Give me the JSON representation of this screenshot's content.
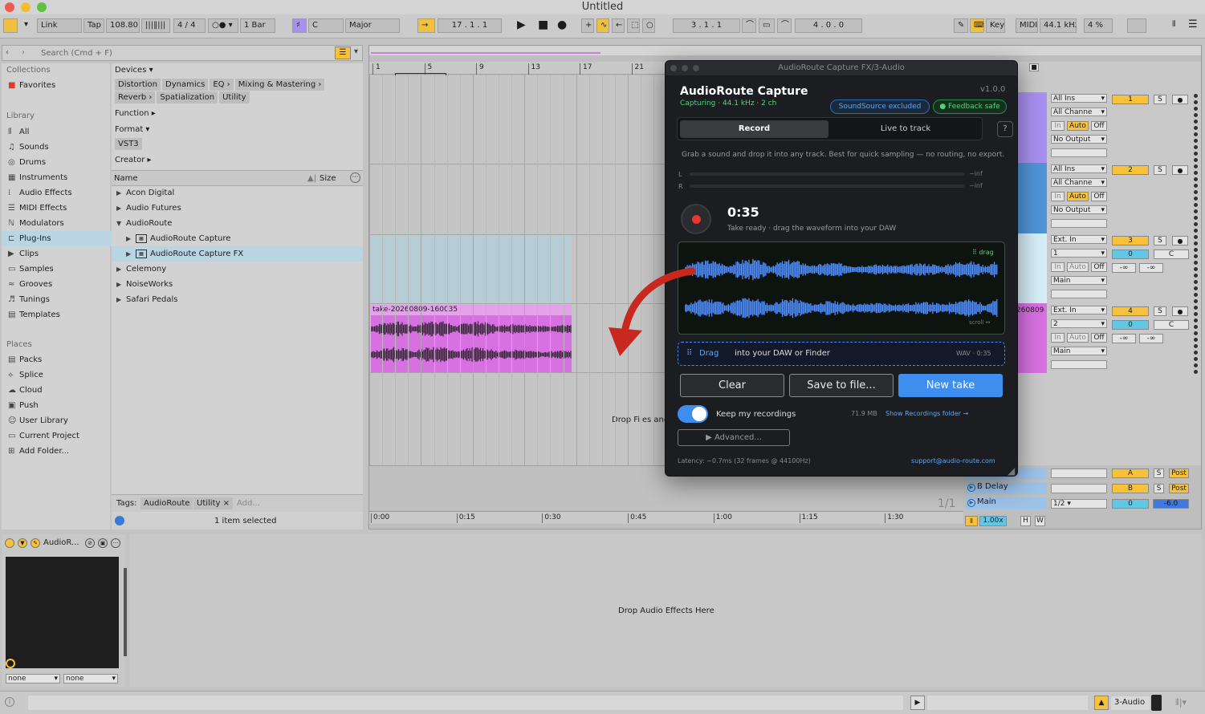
{
  "app": {
    "title": "Untitled"
  },
  "toolbar": {
    "link": "Link",
    "tap": "Tap",
    "tempo": "108.80",
    "signature": "4 / 4",
    "quantize": "1 Bar",
    "key": "C",
    "scale": "Major",
    "position": "17 .   1 .   1",
    "loop_start": "3 .   1 .   1",
    "loop_length": "4 .   0 .   0",
    "key_label": "Key",
    "midi_label": "MIDI",
    "sample_rate": "44.1 kHz",
    "cpu": "4 %"
  },
  "search": {
    "placeholder": "Search (Cmd + F)"
  },
  "sidebar": {
    "collections_header": "Collections",
    "favorites": "Favorites",
    "library_header": "Library",
    "library": [
      {
        "icon": "all-icon",
        "glyph": "⦀",
        "label": "All"
      },
      {
        "icon": "sounds-icon",
        "glyph": "♫",
        "label": "Sounds"
      },
      {
        "icon": "drums-icon",
        "glyph": "◎",
        "label": "Drums"
      },
      {
        "icon": "instruments-icon",
        "glyph": "▦",
        "label": "Instruments"
      },
      {
        "icon": "audio-effects-icon",
        "glyph": "⁞",
        "label": "Audio Effects"
      },
      {
        "icon": "midi-effects-icon",
        "glyph": "☰",
        "label": "MIDI Effects"
      },
      {
        "icon": "modulators-icon",
        "glyph": "ℕ",
        "label": "Modulators"
      },
      {
        "icon": "plugins-icon",
        "glyph": "⊏",
        "label": "Plug-Ins"
      },
      {
        "icon": "clips-icon",
        "glyph": "▶",
        "label": "Clips"
      },
      {
        "icon": "samples-icon",
        "glyph": "▭",
        "label": "Samples"
      },
      {
        "icon": "grooves-icon",
        "glyph": "≈",
        "label": "Grooves"
      },
      {
        "icon": "tunings-icon",
        "glyph": "♬",
        "label": "Tunings"
      },
      {
        "icon": "templates-icon",
        "glyph": "▤",
        "label": "Templates"
      }
    ],
    "places_header": "Places",
    "places": [
      {
        "icon": "packs-icon",
        "glyph": "▤",
        "label": "Packs"
      },
      {
        "icon": "splice-icon",
        "glyph": "⟡",
        "label": "Splice"
      },
      {
        "icon": "cloud-icon",
        "glyph": "☁",
        "label": "Cloud"
      },
      {
        "icon": "push-icon",
        "glyph": "▣",
        "label": "Push"
      },
      {
        "icon": "user-library-icon",
        "glyph": "☺",
        "label": "User Library"
      },
      {
        "icon": "current-project-icon",
        "glyph": "▭",
        "label": "Current Project"
      },
      {
        "icon": "add-folder-icon",
        "glyph": "⊞",
        "label": "Add Folder..."
      }
    ]
  },
  "filters": {
    "devices": "Devices ▾",
    "device_chips": [
      "Distortion",
      "Dynamics",
      "EQ ›",
      "Mixing & Mastering ›"
    ],
    "device_chips2": [
      "Reverb ›",
      "Spatialization",
      "Utility"
    ],
    "function": "Function ▸",
    "format": "Format ▾",
    "format_chip": "VST3",
    "creator": "Creator ▸"
  },
  "browser": {
    "col_name": "Name",
    "col_size": "Size",
    "rows": [
      {
        "label": "Acon Digital",
        "arrow": "▶",
        "indent": 0
      },
      {
        "label": "Audio Futures",
        "arrow": "▶",
        "indent": 0
      },
      {
        "label": "AudioRoute",
        "arrow": "▼",
        "indent": 0
      },
      {
        "label": "AudioRoute Capture",
        "arrow": "▶",
        "indent": 1
      },
      {
        "label": "AudioRoute Capture FX",
        "arrow": "▶",
        "indent": 1
      },
      {
        "label": "Celemony",
        "arrow": "▶",
        "indent": 0
      },
      {
        "label": "NoiseWorks",
        "arrow": "▶",
        "indent": 0
      },
      {
        "label": "Safari Pedals",
        "arrow": "▶",
        "indent": 0
      }
    ],
    "tags_label": "Tags:",
    "tags": [
      "AudioRoute",
      "Utility ×"
    ],
    "tags_add": "Add...",
    "status": "1 item selected"
  },
  "arrangement": {
    "bars": [
      "1",
      "5",
      "9",
      "13",
      "17",
      "21"
    ],
    "clip_name": "take-20260809-160035",
    "clip_name2": "260809",
    "drop_text": "Drop Files and",
    "times": [
      "0:00",
      "0:15",
      "0:30",
      "0:45",
      "1:00",
      "1:15",
      "1:30"
    ],
    "page": "1/1",
    "zoom": "1.00x",
    "h": "H",
    "w": "W"
  },
  "mixer": {
    "tracks": [
      {
        "input": "All Ins",
        "channel": "All Channe",
        "in": "In",
        "auto": "Auto",
        "off": "Off",
        "output": "No Output",
        "num": "1",
        "s": "S"
      },
      {
        "input": "All Ins",
        "channel": "All Channe",
        "in": "In",
        "auto": "Auto",
        "off": "Off",
        "output": "No Output",
        "num": "2",
        "s": "S"
      },
      {
        "input": "Ext. In",
        "channel": "1",
        "in": "In",
        "auto": "Auto",
        "off": "Off",
        "output": "Main",
        "num": "3",
        "s": "S",
        "vol": "0",
        "pan": "C",
        "vl": "-∞",
        "vr": "-∞"
      },
      {
        "input": "Ext. In",
        "channel": "2",
        "in": "In",
        "auto": "Auto",
        "off": "Off",
        "output": "Main",
        "num": "4",
        "s": "S",
        "vol": "0",
        "pan": "C",
        "vl": "-∞",
        "vr": "-∞"
      }
    ],
    "returns": [
      {
        "name": "A",
        "s": "S",
        "post": "Post"
      },
      {
        "name": "B Delay",
        "letter": "B",
        "s": "S",
        "post": "Post"
      }
    ],
    "main": {
      "name": "Main",
      "ratio": "1/2",
      "vol": "0",
      "db": "-6.0"
    }
  },
  "plugin": {
    "window_title": "AudioRoute Capture FX/3-Audio",
    "name": "AudioRoute Capture",
    "version": "v1.0.0",
    "status": "Capturing · 44.1 kHz · 2 ch",
    "badge_excluded": "SoundSource excluded",
    "badge_feedback": "● Feedback safe",
    "tab_record": "Record",
    "tab_live": "Live to track",
    "help": "?",
    "description": "Grab a sound and drop it into any track. Best for quick sampling — no routing, no export.",
    "meter_l": "L",
    "meter_r": "R",
    "meter_l_val": "−inf",
    "meter_r_val": "−inf",
    "time": "0:35",
    "take_status": "Take ready · drag the waveform into your DAW",
    "drag_hint": "⠿ drag",
    "scroll_hint": "scroll ↔",
    "drag_bar_label": "Drag",
    "drag_bar_text": "into your DAW or Finder",
    "drag_bar_info": "WAV · 0:35",
    "clear": "Clear",
    "save": "Save to file...",
    "new_take": "New take",
    "keep_label": "Keep my recordings",
    "storage": "71.9 MB",
    "show_folder": "Show Recordings folder →",
    "advanced": "▶  Advanced...",
    "latency": "Latency: ~0.7ms (32 frames @ 44100Hz)",
    "support": "support@audio-route.com",
    "keep_on": true
  },
  "device": {
    "title": "AudioR...",
    "sel1": "none",
    "sel2": "none",
    "drop_text": "Drop Audio Effects Here"
  },
  "statusbar": {
    "track": "3-Audio"
  },
  "colors": {
    "accent_blue": "#3e8ef0",
    "clip_pink": "#d770e0",
    "record_red": "#e8372c",
    "yellow": "#f7c23a",
    "cyan": "#62c7e4",
    "green": "#55d07a"
  }
}
